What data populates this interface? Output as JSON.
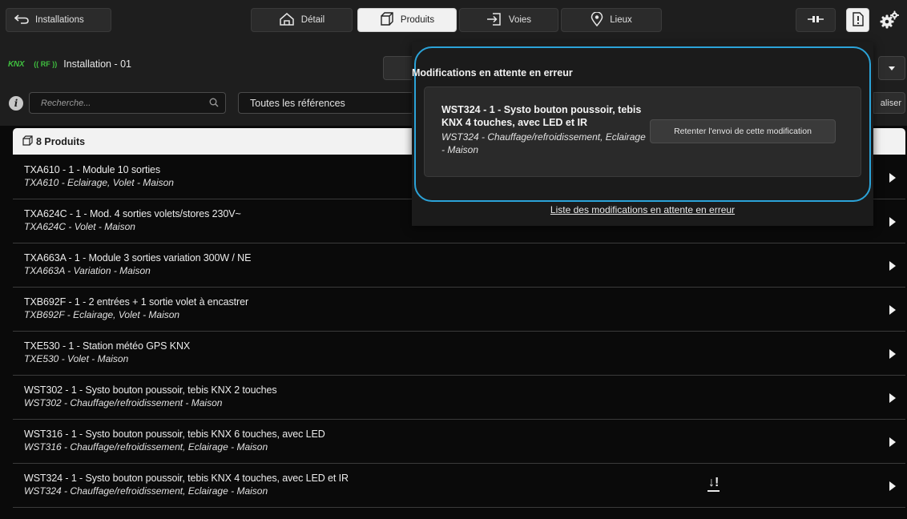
{
  "topbar": {
    "back_label": "Installations",
    "tabs": [
      {
        "label": "Détail",
        "icon": "home-icon"
      },
      {
        "label": "Produits",
        "icon": "box-icon",
        "active": true
      },
      {
        "label": "Voies",
        "icon": "login-icon"
      },
      {
        "label": "Lieux",
        "icon": "location-pin-icon"
      }
    ]
  },
  "installation": {
    "knx_logo": "KNX",
    "rf_logo": "RF",
    "title": "Installation - 01"
  },
  "filters": {
    "search_placeholder": "Recherche...",
    "reference_select": "Toutes les références",
    "right_button_partial": "aliser"
  },
  "products": {
    "header": "8 Produits",
    "items": [
      {
        "line1": "TXA610 - 1 - Module 10 sorties",
        "line2": "TXA610 - Eclairage, Volet - Maison"
      },
      {
        "line1": "TXA624C - 1 - Mod. 4 sorties volets/stores 230V~",
        "line2": "TXA624C - Volet - Maison"
      },
      {
        "line1": "TXA663A - 1 - Module 3 sorties variation 300W / NE",
        "line2": "TXA663A - Variation - Maison"
      },
      {
        "line1": "TXB692F - 1 - 2 entrées + 1 sortie volet à encastrer",
        "line2": "TXB692F - Eclairage, Volet - Maison"
      },
      {
        "line1": "TXE530 - 1 - Station météo GPS KNX",
        "line2": "TXE530 - Volet - Maison"
      },
      {
        "line1": "WST302 - 1 - Systo bouton poussoir, tebis KNX 2 touches",
        "line2": "WST302 - Chauffage/refroidissement - Maison"
      },
      {
        "line1": "WST316 - 1 - Systo bouton poussoir, tebis KNX 6 touches, avec LED",
        "line2": "WST316 - Chauffage/refroidissement, Eclairage - Maison"
      },
      {
        "line1": "WST324 - 1 - Systo bouton poussoir, tebis KNX 4 touches, avec LED et IR",
        "line2": "WST324 - Chauffage/refroidissement, Eclairage - Maison",
        "pending": "↓!"
      }
    ]
  },
  "popup": {
    "title": "Modifications en attente en erreur",
    "card_title": "WST324 - 1 - Systo bouton poussoir, tebis KNX 4 touches, avec LED et IR",
    "card_subtitle": "WST324 - Chauffage/refroidissement, Eclairage - Maison",
    "retry_label": "Retenter l'envoi de cette modification",
    "link_label": "Liste des modifications en attente en erreur"
  },
  "colors": {
    "accent": "#2ba3d8",
    "knx_green": "#3fbf3f"
  }
}
